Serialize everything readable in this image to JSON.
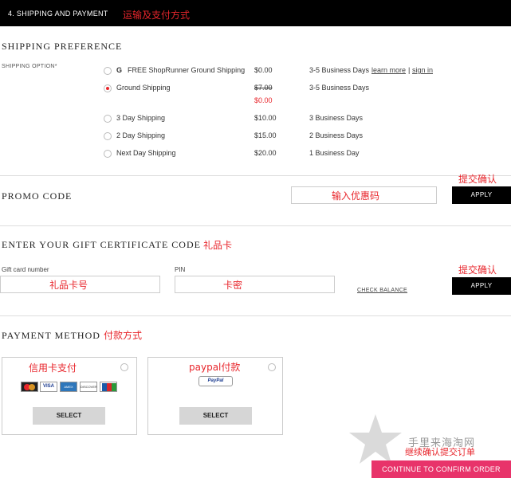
{
  "header": {
    "title": "4. SHIPPING AND PAYMENT",
    "annotation": "运输及支付方式"
  },
  "shipping": {
    "heading": "SHIPPING PREFERENCE",
    "option_label": "SHIPPING OPTION*",
    "options": [
      {
        "badge": "G",
        "name": "FREE ShopRunner Ground Shipping",
        "price": "$0.00",
        "days": "3-5 Business Days",
        "link1": "learn more",
        "sep": "|",
        "link2": "sign in"
      },
      {
        "name": "Ground Shipping",
        "price_strike": "$7.00",
        "price": "$0.00",
        "days": "3-5 Business Days",
        "selected": true
      },
      {
        "name": "3 Day Shipping",
        "price": "$10.00",
        "days": "3 Business Days"
      },
      {
        "name": "2 Day Shipping",
        "price": "$15.00",
        "days": "2 Business Days"
      },
      {
        "name": "Next Day Shipping",
        "price": "$20.00",
        "days": "1 Business Day"
      }
    ]
  },
  "promo": {
    "heading": "PROMO CODE",
    "input_annotation": "输入优惠码",
    "apply_label": "APPLY",
    "apply_annotation": "提交确认"
  },
  "gift": {
    "heading": "ENTER YOUR GIFT CERTIFICATE CODE",
    "heading_annotation": "礼品卡",
    "card_number_label": "Gift card number",
    "card_number_annotation": "礼品卡号",
    "pin_label": "PIN",
    "pin_annotation": "卡密",
    "check_balance": "CHECK BALANCE",
    "apply_label": "APPLY",
    "apply_annotation": "提交确认"
  },
  "payment": {
    "heading": "PAYMENT METHOD",
    "heading_annotation": "付款方式",
    "methods": [
      {
        "annotation": "信用卡支付",
        "select_label": "SELECT"
      },
      {
        "annotation": "paypal付款",
        "logo_text": "PayPal",
        "select_label": "SELECT"
      }
    ],
    "card_logos": [
      "MasterCard",
      "VISA",
      "AMEX",
      "DISCOVER",
      "Diners",
      "JCB"
    ]
  },
  "footer": {
    "continue_label": "CONTINUE TO CONFIRM ORDER",
    "continue_annotation": "继续确认提交订单",
    "watermark": "手里来海淘网"
  },
  "colors": {
    "annotation_red": "#e8262c",
    "header_bg": "#000000",
    "continue_bg": "#e8336a"
  }
}
